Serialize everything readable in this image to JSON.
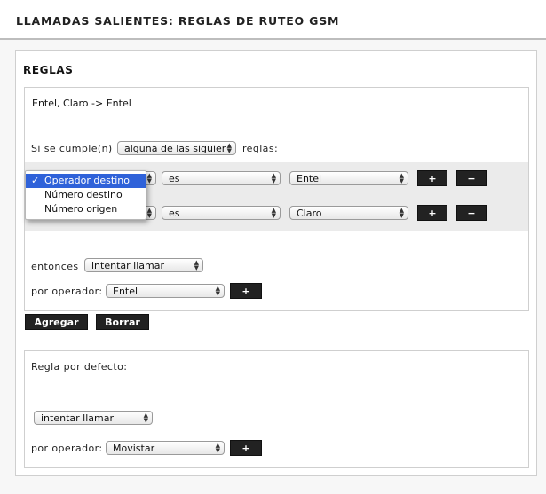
{
  "header": {
    "title": "LLAMADAS SALIENTES: REGLAS DE RUTEO GSM"
  },
  "section": {
    "title": "REGLAS"
  },
  "rule": {
    "name": "Entel, Claro -> Entel",
    "if_label": "Si se cumple(n)",
    "match_value": "alguna de las siguier",
    "rules_label": "reglas:",
    "conditions": [
      {
        "field": "",
        "operator": "es",
        "value": "Entel"
      },
      {
        "field": "",
        "operator": "es",
        "value": "Claro"
      }
    ],
    "then_label": "entonces",
    "action_value": "intentar llamar",
    "operator_label": "por operador:",
    "operator_value": "Entel"
  },
  "dropdown": {
    "options": [
      "Operador destino",
      "Número destino",
      "Número origen"
    ],
    "selected": "Operador destino"
  },
  "buttons": {
    "add": "+",
    "remove": "−",
    "agregar": "Agregar",
    "borrar": "Borrar"
  },
  "default_rule": {
    "label": "Regla por defecto:",
    "action_value": "intentar llamar",
    "operator_label": "por operador:",
    "operator_value": "Movistar"
  }
}
